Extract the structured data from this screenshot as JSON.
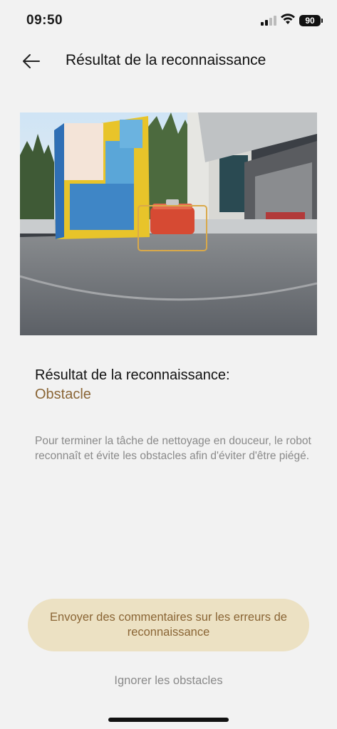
{
  "status_bar": {
    "time": "09:50",
    "battery": "90"
  },
  "header": {
    "title": "Résultat de la reconnaissance",
    "back_icon": "arrow-left-icon"
  },
  "result": {
    "label": "Résultat de la reconnaissance:",
    "value": "Obstacle",
    "description": "Pour terminer la tâche de nettoyage en douceur, le robot reconnaît et évite les obstacles afin d'éviter d'être piégé."
  },
  "actions": {
    "feedback_label": "Envoyer des commentaires sur les erreurs de reconnaissance",
    "ignore_label": "Ignorer les obstacles"
  },
  "colors": {
    "accent": "#8a6535",
    "button_bg": "#ece1c3",
    "background": "#f2f2f2",
    "muted_text": "#8a8a8a",
    "detection_box": "#d9a94a"
  }
}
